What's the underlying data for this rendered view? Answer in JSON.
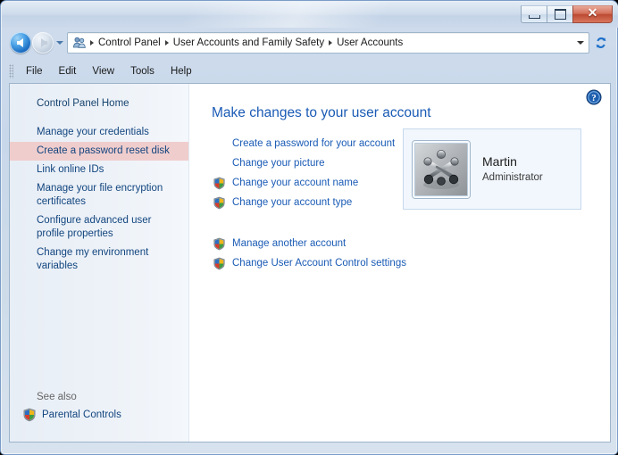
{
  "window": {
    "minimize_label": "Minimize",
    "maximize_label": "Maximize",
    "close_label": "✕"
  },
  "nav": {
    "back_label": "Back",
    "forward_label": "Forward",
    "history_label": "Recent pages",
    "refresh_label": "Refresh",
    "address_dropdown_label": "Previous locations",
    "breadcrumb": [
      "Control Panel",
      "User Accounts and Family Safety",
      "User Accounts"
    ]
  },
  "menubar": {
    "items": [
      "File",
      "Edit",
      "View",
      "Tools",
      "Help"
    ]
  },
  "sidebar": {
    "home_label": "Control Panel Home",
    "items": [
      {
        "label": "Manage your credentials",
        "highlighted": false
      },
      {
        "label": "Create a password reset disk",
        "highlighted": true
      },
      {
        "label": "Link online IDs",
        "highlighted": false
      },
      {
        "label": "Manage your file encryption certificates",
        "highlighted": false
      },
      {
        "label": "Configure advanced user profile properties",
        "highlighted": false
      },
      {
        "label": "Change my environment variables",
        "highlighted": false
      }
    ],
    "see_also_label": "See also",
    "parental_controls_label": "Parental Controls"
  },
  "main": {
    "help_label": "Help",
    "title": "Make changes to your user account",
    "primary_tasks": [
      {
        "label": "Create a password for your account",
        "shield": false
      },
      {
        "label": "Change your picture",
        "shield": false
      },
      {
        "label": "Change your account name",
        "shield": true
      },
      {
        "label": "Change your account type",
        "shield": true
      }
    ],
    "secondary_tasks": [
      {
        "label": "Manage another account",
        "shield": true
      },
      {
        "label": "Change User Account Control settings",
        "shield": true
      }
    ],
    "user": {
      "name": "Martin",
      "role": "Administrator"
    }
  },
  "colors": {
    "link_blue": "#1a5bb5",
    "sidebar_link_blue": "#12457f",
    "highlight_pink": "#f0cdcd",
    "close_red": "#bb4a31",
    "tile_bg": "#f2f7fd"
  }
}
